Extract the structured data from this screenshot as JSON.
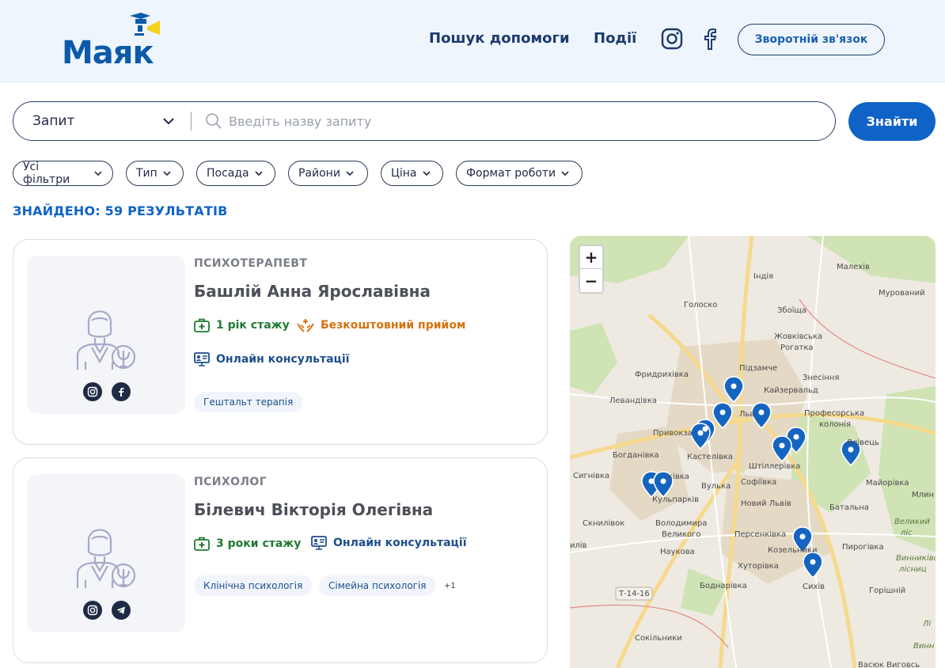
{
  "header": {
    "logo_text": "Маяк",
    "nav": [
      {
        "label": "Пошук допомоги"
      },
      {
        "label": "Події"
      }
    ],
    "social_icons": [
      "instagram-icon",
      "facebook-icon"
    ],
    "contact_button": "Зворотній зв'язок"
  },
  "search": {
    "select_value": "Запит",
    "placeholder": "Введіть назву запиту",
    "button": "Знайти"
  },
  "filters": [
    {
      "label": "Усі фільтри"
    },
    {
      "label": "Тип"
    },
    {
      "label": "Посада"
    },
    {
      "label": "Райони"
    },
    {
      "label": "Ціна"
    },
    {
      "label": "Формат роботи"
    }
  ],
  "results_label": "ЗНАЙДЕНО: 59 РЕЗУЛЬТАТІВ",
  "cards": [
    {
      "role": "ПСИХОТЕРАПЕВТ",
      "name": "Башлій Анна Ярославівна",
      "experience": "1 рік стажу",
      "free": "Безкоштовний прийом",
      "online": "Онлайн консультації",
      "tags": [
        "Гештальт терапія"
      ],
      "socials": [
        "instagram-icon",
        "facebook-icon"
      ]
    },
    {
      "role": "ПСИХОЛОГ",
      "name": "Білевич Вікторія Олегівна",
      "experience": "3 роки стажу",
      "online": "Онлайн консультації",
      "tags": [
        "Клінічна психологія",
        "Сімейна психологія"
      ],
      "more": "+1",
      "socials": [
        "instagram-icon",
        "telegram-icon"
      ]
    }
  ],
  "map": {
    "zoom_in": "+",
    "zoom_out": "−",
    "labels": [
      "Індія",
      "Малехів",
      "Голоско",
      "Збоїща",
      "Мурований",
      "Жовківська",
      "Рогатка",
      "Підзамче",
      "Фридрихівка",
      "Знесіння",
      "Кайзервальд",
      "Левандівка",
      "Льв",
      "Професорська",
      "колонія",
      "Привокза",
      "Кастелівка",
      "Ялівець",
      "Богданівка",
      "Штіллерівка",
      "Сигнівка",
      "ківка",
      "Вулька",
      "Софіївка",
      "Майорівка",
      "Кульпарків",
      "Новий Львів",
      "Батальна",
      "Млин",
      "Скнилівок",
      "Володимира",
      "Великого",
      "Персенківка",
      "Великий",
      "ліс",
      "Наукова",
      "Козельники",
      "Пирогівка",
      "Винниківськ",
      "лісниц",
      "Хуторівка",
      "Боднарівка",
      "Сихів",
      "Горішній",
      "Т-14-16",
      "Сокільники",
      "Васюк Виговсь",
      "Лі",
      "Винн",
      "илів"
    ]
  }
}
